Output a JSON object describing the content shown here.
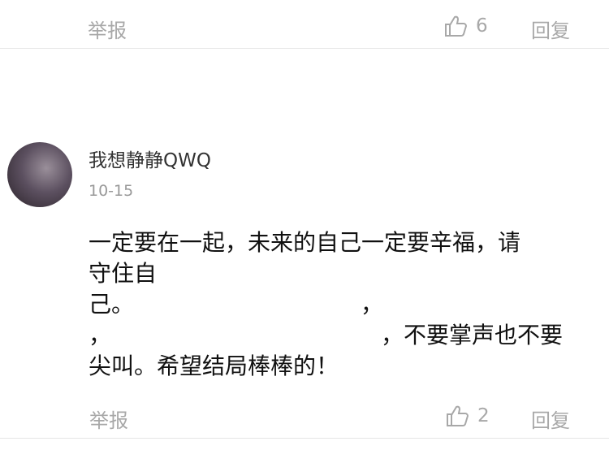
{
  "top_actions": {
    "report_label": "举报",
    "like_count": "6",
    "reply_label": "回复"
  },
  "comment": {
    "username": "我想静静QWQ",
    "date": "10-15",
    "lines": [
      "一定要在一起，未来的自己一定要辛福，请",
      "守住自",
      "己。",
      "，",
      "，",
      "，不要掌声也不要",
      "尖叫。希望结局棒棒的！"
    ],
    "actions": {
      "report_label": "举报",
      "like_count": "2",
      "reply_label": "回复"
    }
  },
  "icons": {
    "like": "thumbs-up-icon"
  },
  "colors": {
    "muted": "#a8a8a8",
    "divider": "#e6e6e6",
    "text": "#111111"
  }
}
